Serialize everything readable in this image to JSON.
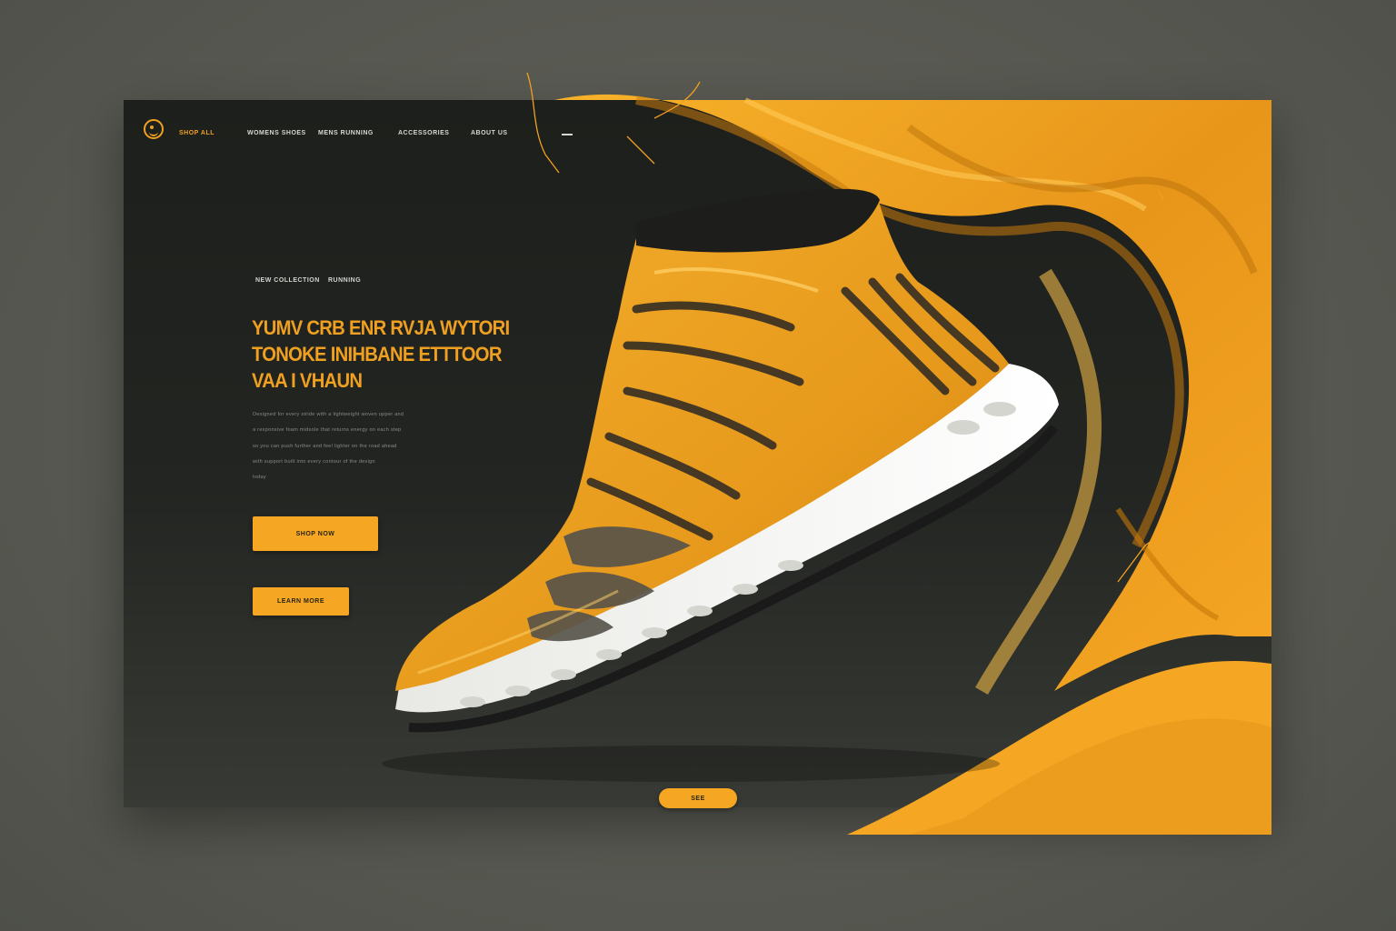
{
  "nav": {
    "items": [
      "SHOP ALL",
      "WOMENS SHOES",
      "MENS RUNNING",
      "ACCESSORIES",
      "ABOUT US"
    ]
  },
  "hero": {
    "eyebrow_left": "NEW COLLECTION",
    "eyebrow_right": "RUNNING",
    "headline_lines": [
      "YUMV CRB ENR RVJA WYTORI",
      "TONOKE INIHBANE ETTTOOR",
      "VAA I VHAUN"
    ],
    "body_lines": [
      "Designed for every stride with a lightweight woven upper and",
      "a responsive foam midsole that returns energy on each step",
      "so you can push further and feel lighter on the road ahead",
      "with support built into every contour of the design",
      "today"
    ],
    "primary_button": "SHOP NOW",
    "secondary_button": "LEARN MORE",
    "scroll_button": "SEE"
  },
  "colors": {
    "accent": "#f5a623",
    "background_dark": "#1d1f1c",
    "page_bg": "#5b5c55"
  }
}
